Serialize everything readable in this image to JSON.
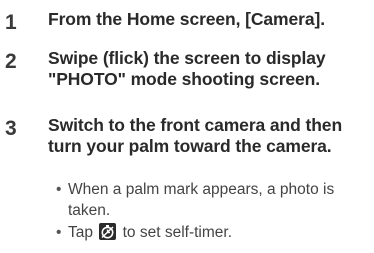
{
  "steps": [
    {
      "number": "1",
      "text": "From the Home screen, [Camera]."
    },
    {
      "number": "2",
      "text": "Swipe (flick) the screen to display \"PHOTO\" mode shooting screen."
    },
    {
      "number": "3",
      "text": "Switch to the front camera and then turn your palm toward the camera."
    }
  ],
  "bullets": [
    {
      "marker": "•",
      "text": "When a palm mark appears, a photo is taken."
    },
    {
      "marker": "•",
      "text_before": "Tap",
      "icon": "self-timer-icon",
      "text_after": "to set self-timer."
    }
  ]
}
